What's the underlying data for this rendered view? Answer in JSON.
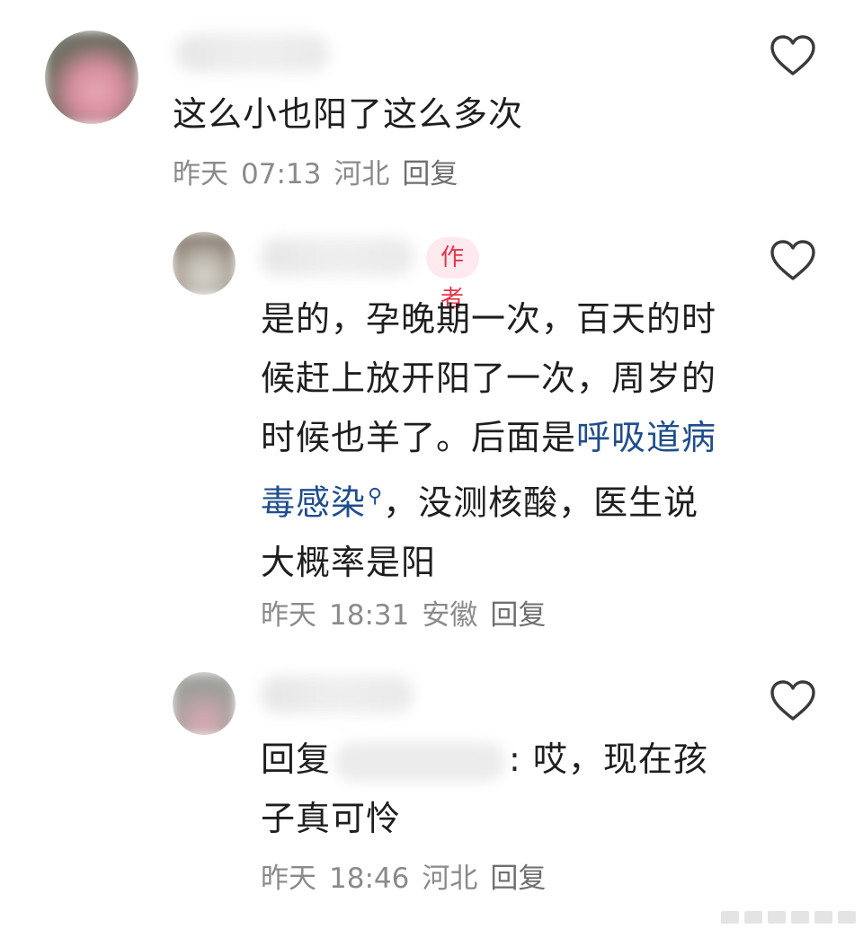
{
  "comments": [
    {
      "text": "这么小也阳了这么多次",
      "meta": {
        "date": "昨天",
        "time": "07:13",
        "location": "河北",
        "reply_label": "回复"
      }
    },
    {
      "badge": "作者",
      "text_before": "是的，孕晚期一次，百天的时候赶上放开阳了一次，周岁的时候也羊了。后面是",
      "link": "呼吸道病毒感染",
      "text_after": "，没测核酸，医生说大概率是阳",
      "meta": {
        "date": "昨天",
        "time": "18:31",
        "location": "安徽",
        "reply_label": "回复"
      }
    },
    {
      "reply_prefix": "回复",
      "text": ": 哎，现在孩子真可怜",
      "meta": {
        "date": "昨天",
        "time": "18:46",
        "location": "河北",
        "reply_label": "回复"
      }
    }
  ],
  "icons": {
    "like": "heart-outline-icon",
    "search_link": "search-icon"
  },
  "colors": {
    "link": "#1f4e8c",
    "badge_text": "#e8334a",
    "badge_bg": "#fde9ee",
    "meta": "#8a8a8a"
  }
}
